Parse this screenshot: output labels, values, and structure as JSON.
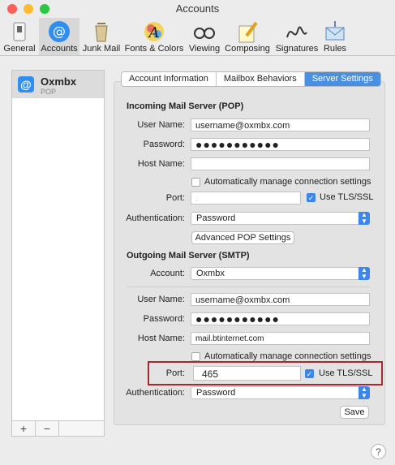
{
  "window": {
    "title": "Accounts"
  },
  "colors": {
    "accent": "#3b86e8",
    "highlight_border": "#a7292d",
    "close": "#fc5f57",
    "minimize": "#fdbc2e",
    "zoom": "#28c840"
  },
  "toolbar": {
    "items": [
      {
        "label": "General",
        "icon": "switch-icon"
      },
      {
        "label": "Accounts",
        "icon": "at-icon"
      },
      {
        "label": "Junk Mail",
        "icon": "trash-bin-icon"
      },
      {
        "label": "Fonts & Colors",
        "icon": "font-palette-icon"
      },
      {
        "label": "Viewing",
        "icon": "glasses-icon"
      },
      {
        "label": "Composing",
        "icon": "pencil-paper-icon"
      },
      {
        "label": "Signatures",
        "icon": "signature-icon"
      },
      {
        "label": "Rules",
        "icon": "envelope-rules-icon"
      }
    ],
    "active": "Accounts"
  },
  "sidebar": {
    "account": {
      "name": "Oxmbx",
      "type": "POP"
    },
    "add_label": "+",
    "remove_label": "−"
  },
  "tabs": [
    {
      "label": "Account Information",
      "active": false
    },
    {
      "label": "Mailbox Behaviors",
      "active": false
    },
    {
      "label": "Server Settings",
      "active": true
    }
  ],
  "incoming": {
    "heading": "Incoming Mail Server (POP)",
    "username_label": "User Name:",
    "username": "username@oxmbx.com",
    "password_label": "Password:",
    "password": "●●●●●●●●●●●",
    "host_label": "Host Name:",
    "host": "",
    "auto_manage_label": "Automatically manage connection settings",
    "port_label": "Port:",
    "port": ".",
    "tls_label": "Use TLS/SSL",
    "auth_label": "Authentication:",
    "auth_value": "Password",
    "advanced_button": "Advanced POP Settings"
  },
  "outgoing": {
    "heading": "Outgoing Mail Server (SMTP)",
    "account_label": "Account:",
    "account_value": "Oxmbx",
    "username_label": "User Name:",
    "username": "username@oxmbx.com",
    "password_label": "Password:",
    "password": "●●●●●●●●●●●",
    "host_label": "Host Name:",
    "host": "mail.btinternet.com",
    "auto_manage_label": "Automatically manage connection settings",
    "port_label": "Port:",
    "port": "465",
    "tls_label": "Use TLS/SSL",
    "auth_label": "Authentication:",
    "auth_value": "Password"
  },
  "save_button": "Save",
  "help_label": "?"
}
